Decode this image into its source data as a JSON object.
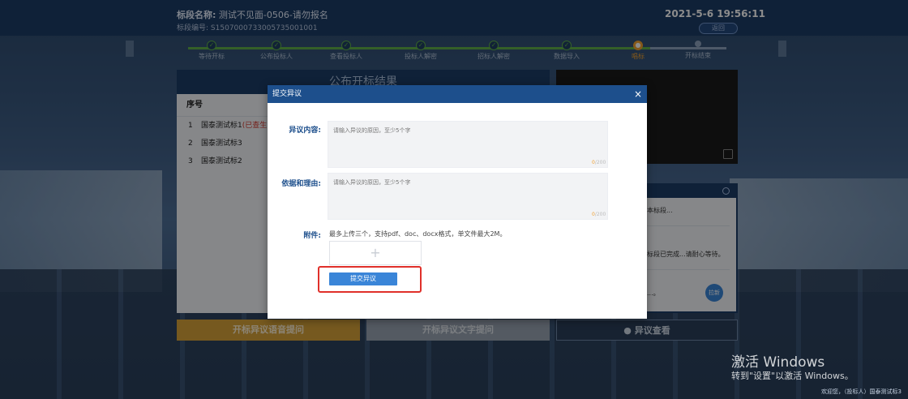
{
  "header": {
    "project_label": "标段名称:",
    "project_value": "测试不见面-0506-请勿报名",
    "code_label": "标段编号:",
    "code_value": "S150700073300573500100​1",
    "datetime": "2021-5-6  19:56:11",
    "return_label": "返回"
  },
  "steps": [
    {
      "label": "等待开标",
      "state": "done"
    },
    {
      "label": "公布投标人",
      "state": "done"
    },
    {
      "label": "查看投标人",
      "state": "done"
    },
    {
      "label": "投标人解密",
      "state": "done"
    },
    {
      "label": "招标人解密",
      "state": "done"
    },
    {
      "label": "数据导入",
      "state": "done"
    },
    {
      "label": "唱标",
      "state": "current"
    },
    {
      "label": "开标结束",
      "state": "pending"
    }
  ],
  "left_panel": {
    "title": "公布开标结果",
    "col_index": "序号",
    "rows": [
      {
        "index": "1",
        "name": "国泰测试标1",
        "tag": "(已查生"
      },
      {
        "index": "2",
        "name": "国泰测试标3",
        "tag": ""
      },
      {
        "index": "3",
        "name": "国泰测试标2",
        "tag": ""
      }
    ]
  },
  "chat": {
    "msg1": "本标段...",
    "msg2": "标段已完成...请耐心等待。",
    "msg3": "...。",
    "send_label": "拉新"
  },
  "bottom": {
    "voice_label": "开标异议语音提问",
    "text_label": "开标异议文字提问",
    "view_label": "异议查看"
  },
  "modal": {
    "title": "提交异议",
    "close": "×",
    "content_label": "异议内容:",
    "content_placeholder": "请输入异议的原因，至少5个字",
    "content_count_cur": "0",
    "content_count_max": "/200",
    "reason_label": "依据和理由:",
    "reason_placeholder": "请输入异议的原因，至少5个字",
    "reason_count_cur": "0",
    "reason_count_max": "/200",
    "attach_label": "附件:",
    "attach_hint": "最多上传三个，支持pdf、doc、docx格式，单文件最大2M。",
    "upload_symbol": "+",
    "submit_label": "提交异议"
  },
  "watermark": {
    "title": "激活 Windows",
    "subtitle": "转到\"设置\"以激活 Windows。",
    "welcome": "欢迎您，（投标人）国泰测试标3"
  },
  "colors": {
    "header_bg": "#1d3c66",
    "accent_blue": "#3a85d8",
    "highlight_red": "#e0302a",
    "progress_green": "#5fb04a",
    "current_orange": "#f0a030"
  }
}
